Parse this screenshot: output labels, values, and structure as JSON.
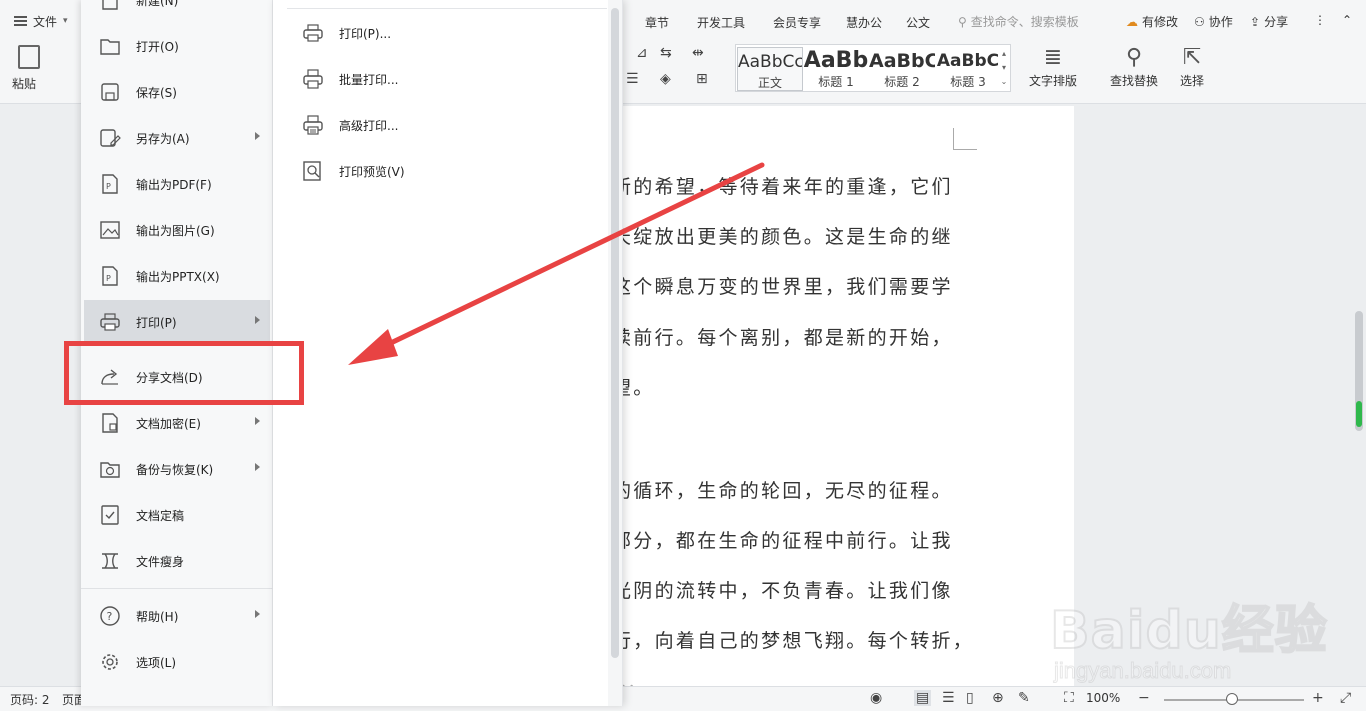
{
  "ribbon": {
    "file_label": "文件",
    "tabs": [
      "章节",
      "开发工具",
      "会员专享",
      "慧办公",
      "公文"
    ],
    "search_placeholder": "查找命令、搜索模板",
    "actions": {
      "revise": "有修改",
      "collab": "协作",
      "share": "分享"
    },
    "paste_label": "粘贴",
    "styles": [
      {
        "sample": "AaBbCcI",
        "name": "正文"
      },
      {
        "sample": "AaBb",
        "name": "标题 1"
      },
      {
        "sample": "AaBbC",
        "name": "标题 2"
      },
      {
        "sample": "AaBbC",
        "name": "标题 3"
      }
    ],
    "text_layout": "文字排版",
    "find_replace": "查找替换",
    "select": "选择"
  },
  "file_menu": {
    "items": [
      {
        "label": "新建(N)",
        "icon": "new-doc-icon"
      },
      {
        "label": "打开(O)",
        "icon": "folder-icon"
      },
      {
        "label": "保存(S)",
        "icon": "save-icon"
      },
      {
        "label": "另存为(A)",
        "icon": "save-as-icon"
      },
      {
        "label": "输出为PDF(F)",
        "icon": "pdf-icon"
      },
      {
        "label": "输出为图片(G)",
        "icon": "image-icon"
      },
      {
        "label": "输出为PPTX(X)",
        "icon": "pptx-icon"
      },
      {
        "label": "打印(P)",
        "icon": "printer-icon"
      },
      {
        "label": "分享文档(D)",
        "icon": "share-icon"
      },
      {
        "label": "文档加密(E)",
        "icon": "encrypt-icon"
      },
      {
        "label": "备份与恢复(K)",
        "icon": "backup-icon"
      },
      {
        "label": "文档定稿",
        "icon": "finalize-icon"
      },
      {
        "label": "文件瘦身",
        "icon": "slim-icon"
      },
      {
        "label": "帮助(H)",
        "icon": "help-icon"
      },
      {
        "label": "选项(L)",
        "icon": "settings-icon"
      }
    ]
  },
  "print_submenu": {
    "items": [
      {
        "label": "打印(P)..."
      },
      {
        "label": "批量打印..."
      },
      {
        "label": "高级打印..."
      },
      {
        "label": "打印预览(V)"
      }
    ]
  },
  "document": {
    "lines": [
      "新的希望，等待着来年的重逢，它们",
      "天绽放出更美的颜色。这是生命的继",
      "这个瞬息万变的世界里，我们需要学",
      "续前行。每个离别，都是新的开始，",
      "望。",
      "",
      "的循环，生命的轮回，无尽的征程。",
      "部分，都在生命的征程中前行。让我",
      "光阴的流转中，不负青春。让我们像",
      "行，向着自己的梦想飞翔。每个转折，",
      "..."
    ]
  },
  "status_bar": {
    "page": "页码: 2",
    "page2": "页面",
    "zoom": "100%"
  },
  "watermark": {
    "brand": "Baidu经验",
    "url": "jingyan.baidu.com"
  },
  "colors": {
    "annotation": "#e84343",
    "accent_green": "#2fb84c"
  }
}
